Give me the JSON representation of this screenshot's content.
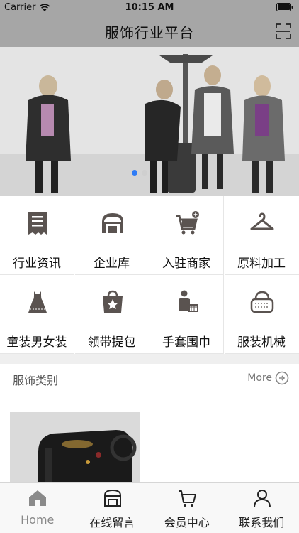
{
  "status_bar": {
    "carrier": "Carrier",
    "time": "10:15 AM"
  },
  "nav": {
    "title": "服饰行业平台"
  },
  "banner": {
    "slide_count": 2,
    "active_slide": 1
  },
  "grid": {
    "items": [
      {
        "label": "行业资讯",
        "icon": "news-icon"
      },
      {
        "label": "企业库",
        "icon": "store-icon"
      },
      {
        "label": "入驻商家",
        "icon": "cart-add-icon"
      },
      {
        "label": "原料加工",
        "icon": "hanger-icon"
      },
      {
        "label": "童装男女装",
        "icon": "dress-icon"
      },
      {
        "label": "领带提包",
        "icon": "star-bag-icon"
      },
      {
        "label": "手套围巾",
        "icon": "person-basket-icon"
      },
      {
        "label": "服装机械",
        "icon": "handbag-icon"
      }
    ]
  },
  "section": {
    "title": "服饰类别",
    "more": "More"
  },
  "tabs": [
    {
      "label": "Home",
      "icon": "home-icon",
      "active": true
    },
    {
      "label": "在线留言",
      "icon": "message-icon",
      "active": false
    },
    {
      "label": "会员中心",
      "icon": "cart-icon",
      "active": false
    },
    {
      "label": "联系我们",
      "icon": "person-icon",
      "active": false
    }
  ],
  "colors": {
    "bar": "#a6a6a6",
    "icon": "#5a5350",
    "accent_dot": "#2f7cf6"
  }
}
